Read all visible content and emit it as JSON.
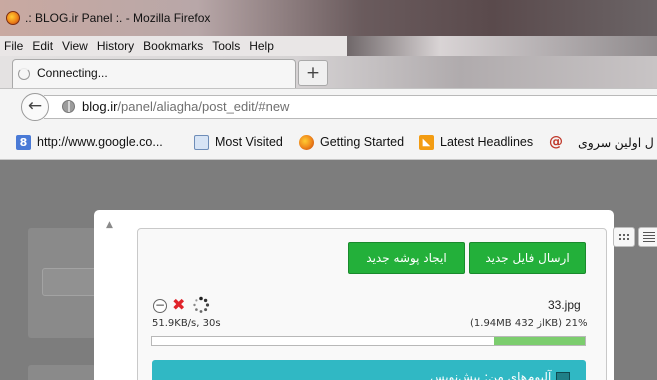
{
  "window": {
    "title": ".: BLOG.ir Panel :. - Mozilla Firefox"
  },
  "menu": {
    "file": "File",
    "edit": "Edit",
    "view": "View",
    "history": "History",
    "bookmarks": "Bookmarks",
    "tools": "Tools",
    "help": "Help"
  },
  "tab": {
    "label": "Connecting...",
    "new_tab": "+"
  },
  "address": {
    "host": "blog.ir",
    "path": "/panel/aliagha/post_edit/#new"
  },
  "bookmarks": [
    {
      "label": "http://www.google.co...",
      "icon": "google-icon"
    },
    {
      "label": "Most Visited",
      "icon": "most-visited-icon"
    },
    {
      "label": "Getting Started",
      "icon": "firefox-icon"
    },
    {
      "label": "Latest Headlines",
      "icon": "rss-icon"
    },
    {
      "label": "@",
      "icon": "at-icon"
    },
    {
      "label": "ل اولین سروی",
      "icon": ""
    }
  ],
  "uploader": {
    "upload_button": "ارسال فایل جدید",
    "new_folder_button": "ایجاد پوشه جدید",
    "file_name": "33.jpg",
    "file_meta": "(1.94MB از 432KB) 21%",
    "speed": "51.9KB/s, 30s",
    "progress_fraction": 0.21,
    "folder_title": "آلبوم‌های من: پیش‌نویس"
  },
  "colors": {
    "button_green": "#23b03a",
    "progress_fill": "#7ccd6e",
    "folder_bar": "#30b8c4",
    "cancel_red": "#e0232a"
  }
}
